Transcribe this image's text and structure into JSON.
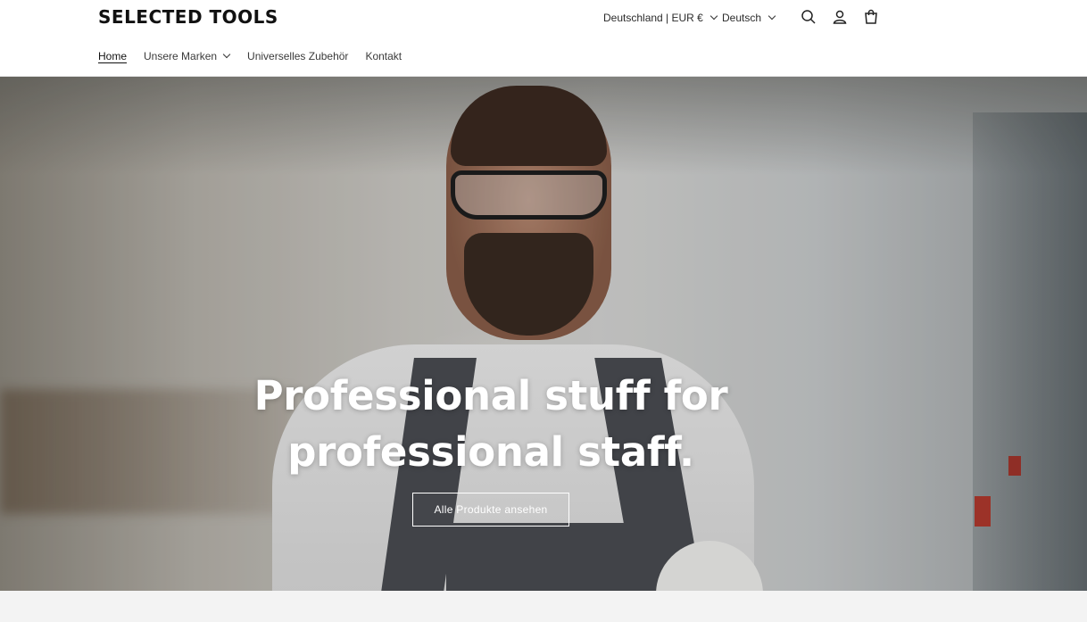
{
  "header": {
    "logo": "SELECTED TOOLS",
    "country_selector": "Deutschland | EUR €",
    "language_selector": "Deutsch",
    "icons": [
      "search-icon",
      "account-icon",
      "cart-icon"
    ]
  },
  "nav": {
    "items": [
      {
        "label": "Home",
        "active": true
      },
      {
        "label": "Unsere Marken",
        "dropdown": true
      },
      {
        "label": "Universelles Zubehör"
      },
      {
        "label": "Kontakt"
      }
    ]
  },
  "hero": {
    "title_line1": "Professional stuff for",
    "title_line2": "professional staff.",
    "button_label": "Alle Produkte ansehen"
  },
  "colors": {
    "text": "#121212",
    "header_bg": "#ffffff",
    "hero_text": "#ffffff",
    "footer_strip": "#f3f3f3"
  }
}
